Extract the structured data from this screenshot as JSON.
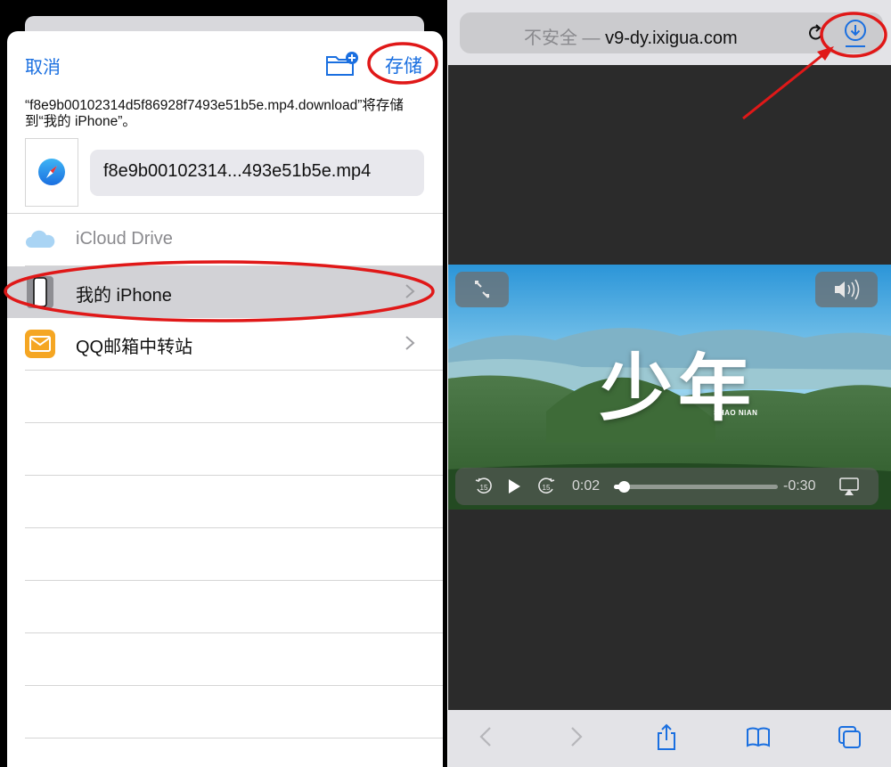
{
  "save_sheet": {
    "cancel_label": "取消",
    "save_label": "存储",
    "message": "“f8e9b00102314d5f86928f7493e51b5e.mp4.download”将存储到“我的 iPhone”。",
    "file_name": "f8e9b00102314...493e51b5e.mp4",
    "locations": [
      {
        "label": "iCloud Drive",
        "icon": "icloud-icon",
        "enabled": false
      },
      {
        "label": "我的 iPhone",
        "icon": "iphone-icon",
        "selected": true
      },
      {
        "label": "QQ邮箱中转站",
        "icon": "mail-icon"
      }
    ]
  },
  "browser": {
    "url_insecure": "不安全 — ",
    "url_host": "v9-dy.ixigua.com",
    "video": {
      "title": "少年",
      "subtitle": "SHAO NIAN",
      "elapsed": "0:02",
      "remaining": "-0:30",
      "progress": 0.06,
      "skip_back_seconds": "15",
      "skip_forward_seconds": "15"
    },
    "toolbar_icons": [
      "back-icon",
      "forward-icon",
      "share-icon",
      "bookmarks-icon",
      "tabs-icon"
    ]
  },
  "colors": {
    "accent": "#1a6fe0",
    "annotation": "#e01818"
  }
}
